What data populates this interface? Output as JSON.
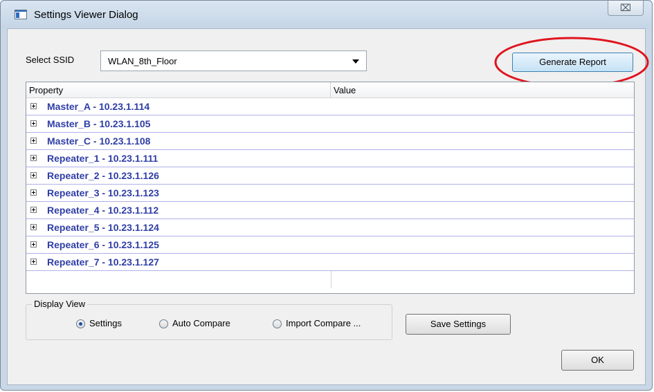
{
  "window": {
    "title": "Settings Viewer Dialog",
    "close_glyph": "⌧"
  },
  "ssid": {
    "label": "Select SSID",
    "selected": "WLAN_8th_Floor"
  },
  "buttons": {
    "generate_report": "Generate Report",
    "save_settings": "Save Settings",
    "ok": "OK"
  },
  "tree": {
    "columns": [
      "Property",
      "Value"
    ],
    "rows": [
      "Master_A - 10.23.1.114",
      "Master_B - 10.23.1.105",
      "Master_C - 10.23.1.108",
      "Repeater_1 - 10.23.1.111",
      "Repeater_2 - 10.23.1.126",
      "Repeater_3 - 10.23.1.123",
      "Repeater_4 - 10.23.1.112",
      "Repeater_5 - 10.23.1.124",
      "Repeater_6 - 10.23.1.125",
      "Repeater_7 - 10.23.1.127"
    ]
  },
  "display_view": {
    "title": "Display View",
    "options": [
      "Settings",
      "Auto Compare",
      "Import Compare ..."
    ],
    "selected": "Settings"
  },
  "colors": {
    "row_text": "#2e3ea6",
    "annotation": "#e0141e"
  },
  "icons": {
    "app": "app-window-icon",
    "expander": "plus-box-icon",
    "dropdown": "chevron-down-icon"
  }
}
